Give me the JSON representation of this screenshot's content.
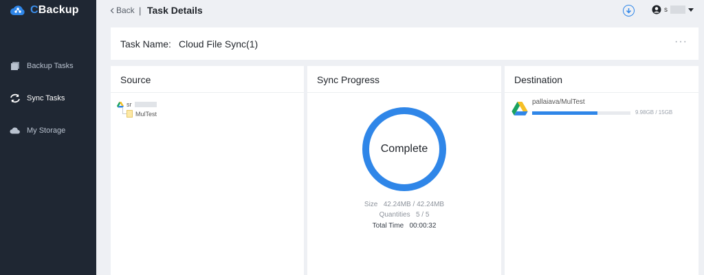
{
  "app": {
    "brand_prefix": "C",
    "brand_suffix": "Backup"
  },
  "sidebar": {
    "items": [
      {
        "label": "Backup Tasks",
        "icon": "copy-icon"
      },
      {
        "label": "Sync Tasks",
        "icon": "sync-icon",
        "active": true
      },
      {
        "label": "My Storage",
        "icon": "cloud-icon"
      }
    ]
  },
  "header": {
    "back_label": "Back",
    "separator": "|",
    "title": "Task Details",
    "user_initial": "s"
  },
  "task": {
    "name_label": "Task Name:",
    "name_value": "Cloud File Sync(1)",
    "more": "···"
  },
  "source": {
    "title": "Source",
    "root_prefix": "sr",
    "child": "MulTest"
  },
  "progress": {
    "title": "Sync Progress",
    "status": "Complete",
    "size_label": "Size",
    "size_value": "42.24MB / 42.24MB",
    "quantities_label": "Quantities",
    "quantities_value": "5 / 5",
    "time_label": "Total Time",
    "time_value": "00:00:32"
  },
  "destination": {
    "title": "Destination",
    "path": "pallaiava/MulTest",
    "usage": "9.98GB / 15GB",
    "usage_fraction": 0.665
  },
  "colors": {
    "accent": "#2f86e8",
    "sidebar_bg": "#1f2733"
  }
}
